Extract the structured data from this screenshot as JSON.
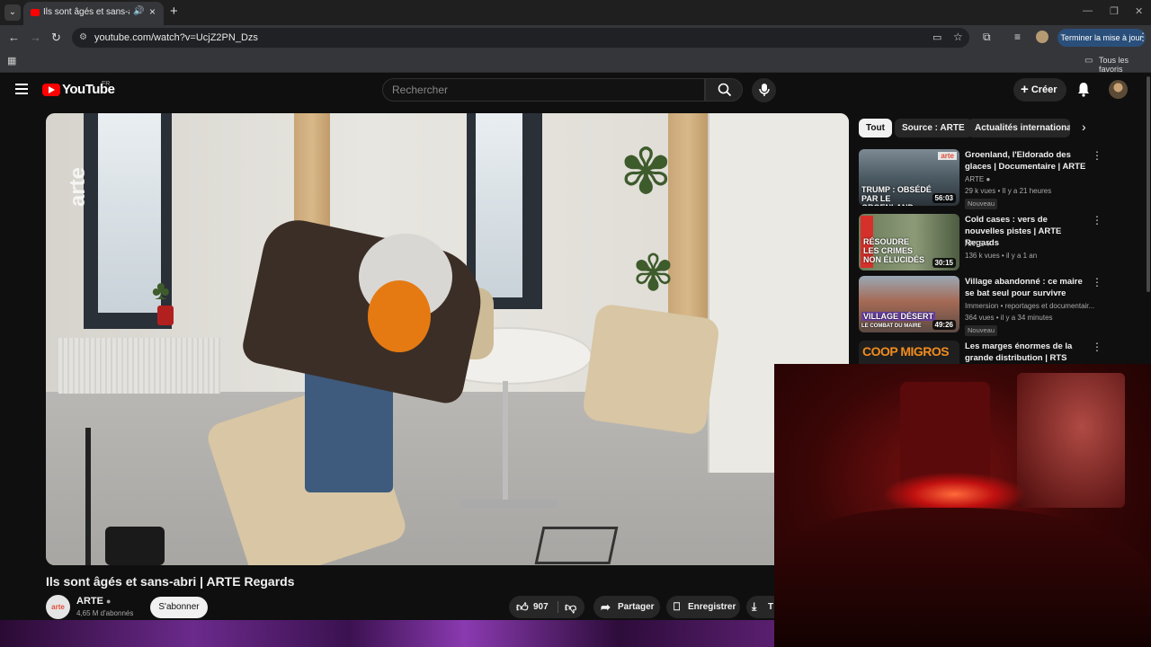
{
  "browser": {
    "tab_title": "Ils sont âgés et sans-abri | ARTE Regards",
    "url": "youtube.com/watch?v=UcjZ2PN_Dzs",
    "update_button": "Terminer la mise à jour",
    "bookmarks_label": "Tous les favoris"
  },
  "header": {
    "logo_text": "YouTube",
    "logo_region": "FR",
    "search_placeholder": "Rechercher",
    "create_label": "Créer"
  },
  "video": {
    "watermark": "arte",
    "title": "Ils sont âgés et sans-abri | ARTE Regards",
    "channel": "ARTE",
    "subscribers": "4,65 M d'abonnés",
    "subscribe_label": "S'abonner",
    "likes": "907",
    "share_label": "Partager",
    "save_label": "Enregistrer",
    "download_label": "T"
  },
  "chips": [
    "Tout",
    "Source : ARTE",
    "Actualités internationales"
  ],
  "recommendations": [
    {
      "title": "Groenland, l'Eldorado des glaces | Documentaire | ARTE",
      "channel": "ARTE",
      "meta": "29 k vues • Il y a 21 heures",
      "badge": "Nouveau",
      "duration": "56:03",
      "thumb_text": "TRUMP : OBSÉDÉ PAR LE GROENLAND",
      "thumb_logo": "arte"
    },
    {
      "title": "Cold cases : vers de nouvelles pistes | ARTE Regards",
      "channel": "ARTE",
      "meta": "136 k vues • il y a 1 an",
      "badge": "",
      "duration": "30:15",
      "thumb_text": "RÉSOUDRE LES CRIMES NON ÉLUCIDÉS",
      "thumb_logo": ""
    },
    {
      "title": "Village abandonné : ce maire se bat seul pour survivre",
      "channel": "Immersion • reportages et documentair...",
      "meta": "364 vues • il y a 34 minutes",
      "badge": "Nouveau",
      "duration": "49:26",
      "thumb_text": "VILLAGE DÉSERT",
      "thumb_sub": "LE COMBAT DU MAIRE",
      "thumb_logo": ""
    },
    {
      "title": "Les marges énormes de la grande distribution | RTS",
      "channel": "",
      "meta": "",
      "badge": "",
      "duration": "",
      "thumb_text": "COOP MIGROS",
      "thumb_logo": ""
    }
  ],
  "colors": {
    "yt_red": "#ff0000",
    "update_blue": "#2a4f7a",
    "hat_orange": "#e57a13"
  }
}
